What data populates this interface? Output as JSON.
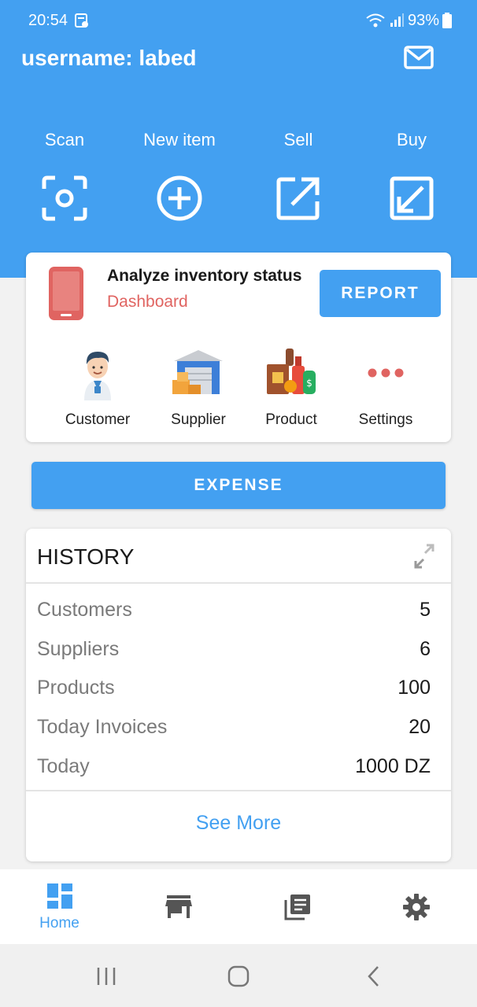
{
  "status_bar": {
    "time": "20:54",
    "battery": "93%"
  },
  "header": {
    "username": "username: labed"
  },
  "actions": [
    {
      "label": "Scan",
      "icon": "scan-icon"
    },
    {
      "label": "New item",
      "icon": "add-circle-icon"
    },
    {
      "label": "Sell",
      "icon": "sell-arrow-icon"
    },
    {
      "label": "Buy",
      "icon": "buy-arrow-icon"
    }
  ],
  "dashboard": {
    "title": "Analyze inventory status",
    "subtitle": "Dashboard",
    "report_label": "REPORT",
    "tiles": [
      {
        "label": "Customer",
        "icon": "customer-icon"
      },
      {
        "label": "Supplier",
        "icon": "supplier-icon"
      },
      {
        "label": "Product",
        "icon": "product-icon"
      },
      {
        "label": "Settings",
        "icon": "more-dots-icon"
      }
    ]
  },
  "expense_label": "EXPENSE",
  "history": {
    "title": "HISTORY",
    "rows": [
      {
        "label": "Customers",
        "value": "5"
      },
      {
        "label": "Suppliers",
        "value": "6"
      },
      {
        "label": "Products",
        "value": "100"
      },
      {
        "label": "Today Invoices",
        "value": "20"
      },
      {
        "label": "Today",
        "value": "1000 DZ"
      }
    ],
    "see_more": "See More"
  },
  "bottom_nav": [
    {
      "label": "Home",
      "icon": "home-dashboard-icon",
      "active": true
    },
    {
      "label": "",
      "icon": "store-icon"
    },
    {
      "label": "",
      "icon": "library-books-icon"
    },
    {
      "label": "",
      "icon": "settings-gear-icon"
    }
  ],
  "colors": {
    "primary": "#43a0f1",
    "accent_red": "#e06461",
    "background": "#f2f2f2"
  }
}
